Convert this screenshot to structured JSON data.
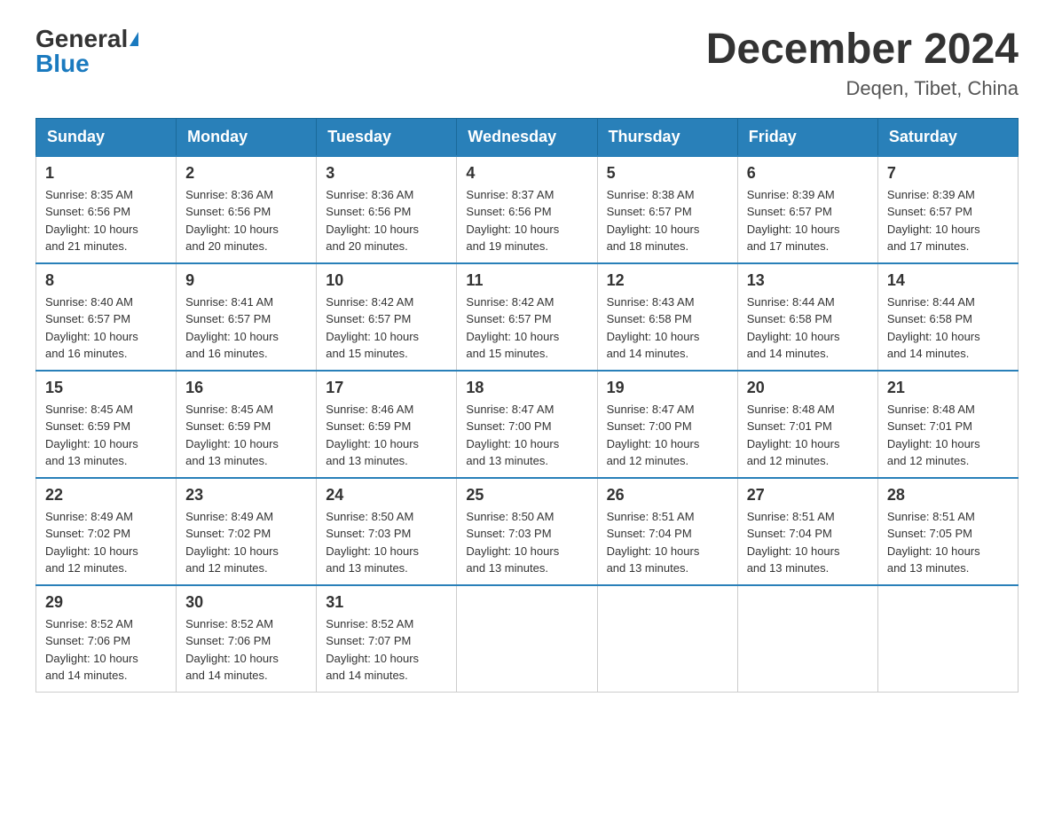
{
  "header": {
    "logo_general": "General",
    "logo_blue": "Blue",
    "month_year": "December 2024",
    "location": "Deqen, Tibet, China"
  },
  "days_of_week": [
    "Sunday",
    "Monday",
    "Tuesday",
    "Wednesday",
    "Thursday",
    "Friday",
    "Saturday"
  ],
  "weeks": [
    [
      {
        "day": "1",
        "info": "Sunrise: 8:35 AM\nSunset: 6:56 PM\nDaylight: 10 hours\nand 21 minutes."
      },
      {
        "day": "2",
        "info": "Sunrise: 8:36 AM\nSunset: 6:56 PM\nDaylight: 10 hours\nand 20 minutes."
      },
      {
        "day": "3",
        "info": "Sunrise: 8:36 AM\nSunset: 6:56 PM\nDaylight: 10 hours\nand 20 minutes."
      },
      {
        "day": "4",
        "info": "Sunrise: 8:37 AM\nSunset: 6:56 PM\nDaylight: 10 hours\nand 19 minutes."
      },
      {
        "day": "5",
        "info": "Sunrise: 8:38 AM\nSunset: 6:57 PM\nDaylight: 10 hours\nand 18 minutes."
      },
      {
        "day": "6",
        "info": "Sunrise: 8:39 AM\nSunset: 6:57 PM\nDaylight: 10 hours\nand 17 minutes."
      },
      {
        "day": "7",
        "info": "Sunrise: 8:39 AM\nSunset: 6:57 PM\nDaylight: 10 hours\nand 17 minutes."
      }
    ],
    [
      {
        "day": "8",
        "info": "Sunrise: 8:40 AM\nSunset: 6:57 PM\nDaylight: 10 hours\nand 16 minutes."
      },
      {
        "day": "9",
        "info": "Sunrise: 8:41 AM\nSunset: 6:57 PM\nDaylight: 10 hours\nand 16 minutes."
      },
      {
        "day": "10",
        "info": "Sunrise: 8:42 AM\nSunset: 6:57 PM\nDaylight: 10 hours\nand 15 minutes."
      },
      {
        "day": "11",
        "info": "Sunrise: 8:42 AM\nSunset: 6:57 PM\nDaylight: 10 hours\nand 15 minutes."
      },
      {
        "day": "12",
        "info": "Sunrise: 8:43 AM\nSunset: 6:58 PM\nDaylight: 10 hours\nand 14 minutes."
      },
      {
        "day": "13",
        "info": "Sunrise: 8:44 AM\nSunset: 6:58 PM\nDaylight: 10 hours\nand 14 minutes."
      },
      {
        "day": "14",
        "info": "Sunrise: 8:44 AM\nSunset: 6:58 PM\nDaylight: 10 hours\nand 14 minutes."
      }
    ],
    [
      {
        "day": "15",
        "info": "Sunrise: 8:45 AM\nSunset: 6:59 PM\nDaylight: 10 hours\nand 13 minutes."
      },
      {
        "day": "16",
        "info": "Sunrise: 8:45 AM\nSunset: 6:59 PM\nDaylight: 10 hours\nand 13 minutes."
      },
      {
        "day": "17",
        "info": "Sunrise: 8:46 AM\nSunset: 6:59 PM\nDaylight: 10 hours\nand 13 minutes."
      },
      {
        "day": "18",
        "info": "Sunrise: 8:47 AM\nSunset: 7:00 PM\nDaylight: 10 hours\nand 13 minutes."
      },
      {
        "day": "19",
        "info": "Sunrise: 8:47 AM\nSunset: 7:00 PM\nDaylight: 10 hours\nand 12 minutes."
      },
      {
        "day": "20",
        "info": "Sunrise: 8:48 AM\nSunset: 7:01 PM\nDaylight: 10 hours\nand 12 minutes."
      },
      {
        "day": "21",
        "info": "Sunrise: 8:48 AM\nSunset: 7:01 PM\nDaylight: 10 hours\nand 12 minutes."
      }
    ],
    [
      {
        "day": "22",
        "info": "Sunrise: 8:49 AM\nSunset: 7:02 PM\nDaylight: 10 hours\nand 12 minutes."
      },
      {
        "day": "23",
        "info": "Sunrise: 8:49 AM\nSunset: 7:02 PM\nDaylight: 10 hours\nand 12 minutes."
      },
      {
        "day": "24",
        "info": "Sunrise: 8:50 AM\nSunset: 7:03 PM\nDaylight: 10 hours\nand 13 minutes."
      },
      {
        "day": "25",
        "info": "Sunrise: 8:50 AM\nSunset: 7:03 PM\nDaylight: 10 hours\nand 13 minutes."
      },
      {
        "day": "26",
        "info": "Sunrise: 8:51 AM\nSunset: 7:04 PM\nDaylight: 10 hours\nand 13 minutes."
      },
      {
        "day": "27",
        "info": "Sunrise: 8:51 AM\nSunset: 7:04 PM\nDaylight: 10 hours\nand 13 minutes."
      },
      {
        "day": "28",
        "info": "Sunrise: 8:51 AM\nSunset: 7:05 PM\nDaylight: 10 hours\nand 13 minutes."
      }
    ],
    [
      {
        "day": "29",
        "info": "Sunrise: 8:52 AM\nSunset: 7:06 PM\nDaylight: 10 hours\nand 14 minutes."
      },
      {
        "day": "30",
        "info": "Sunrise: 8:52 AM\nSunset: 7:06 PM\nDaylight: 10 hours\nand 14 minutes."
      },
      {
        "day": "31",
        "info": "Sunrise: 8:52 AM\nSunset: 7:07 PM\nDaylight: 10 hours\nand 14 minutes."
      },
      null,
      null,
      null,
      null
    ]
  ]
}
